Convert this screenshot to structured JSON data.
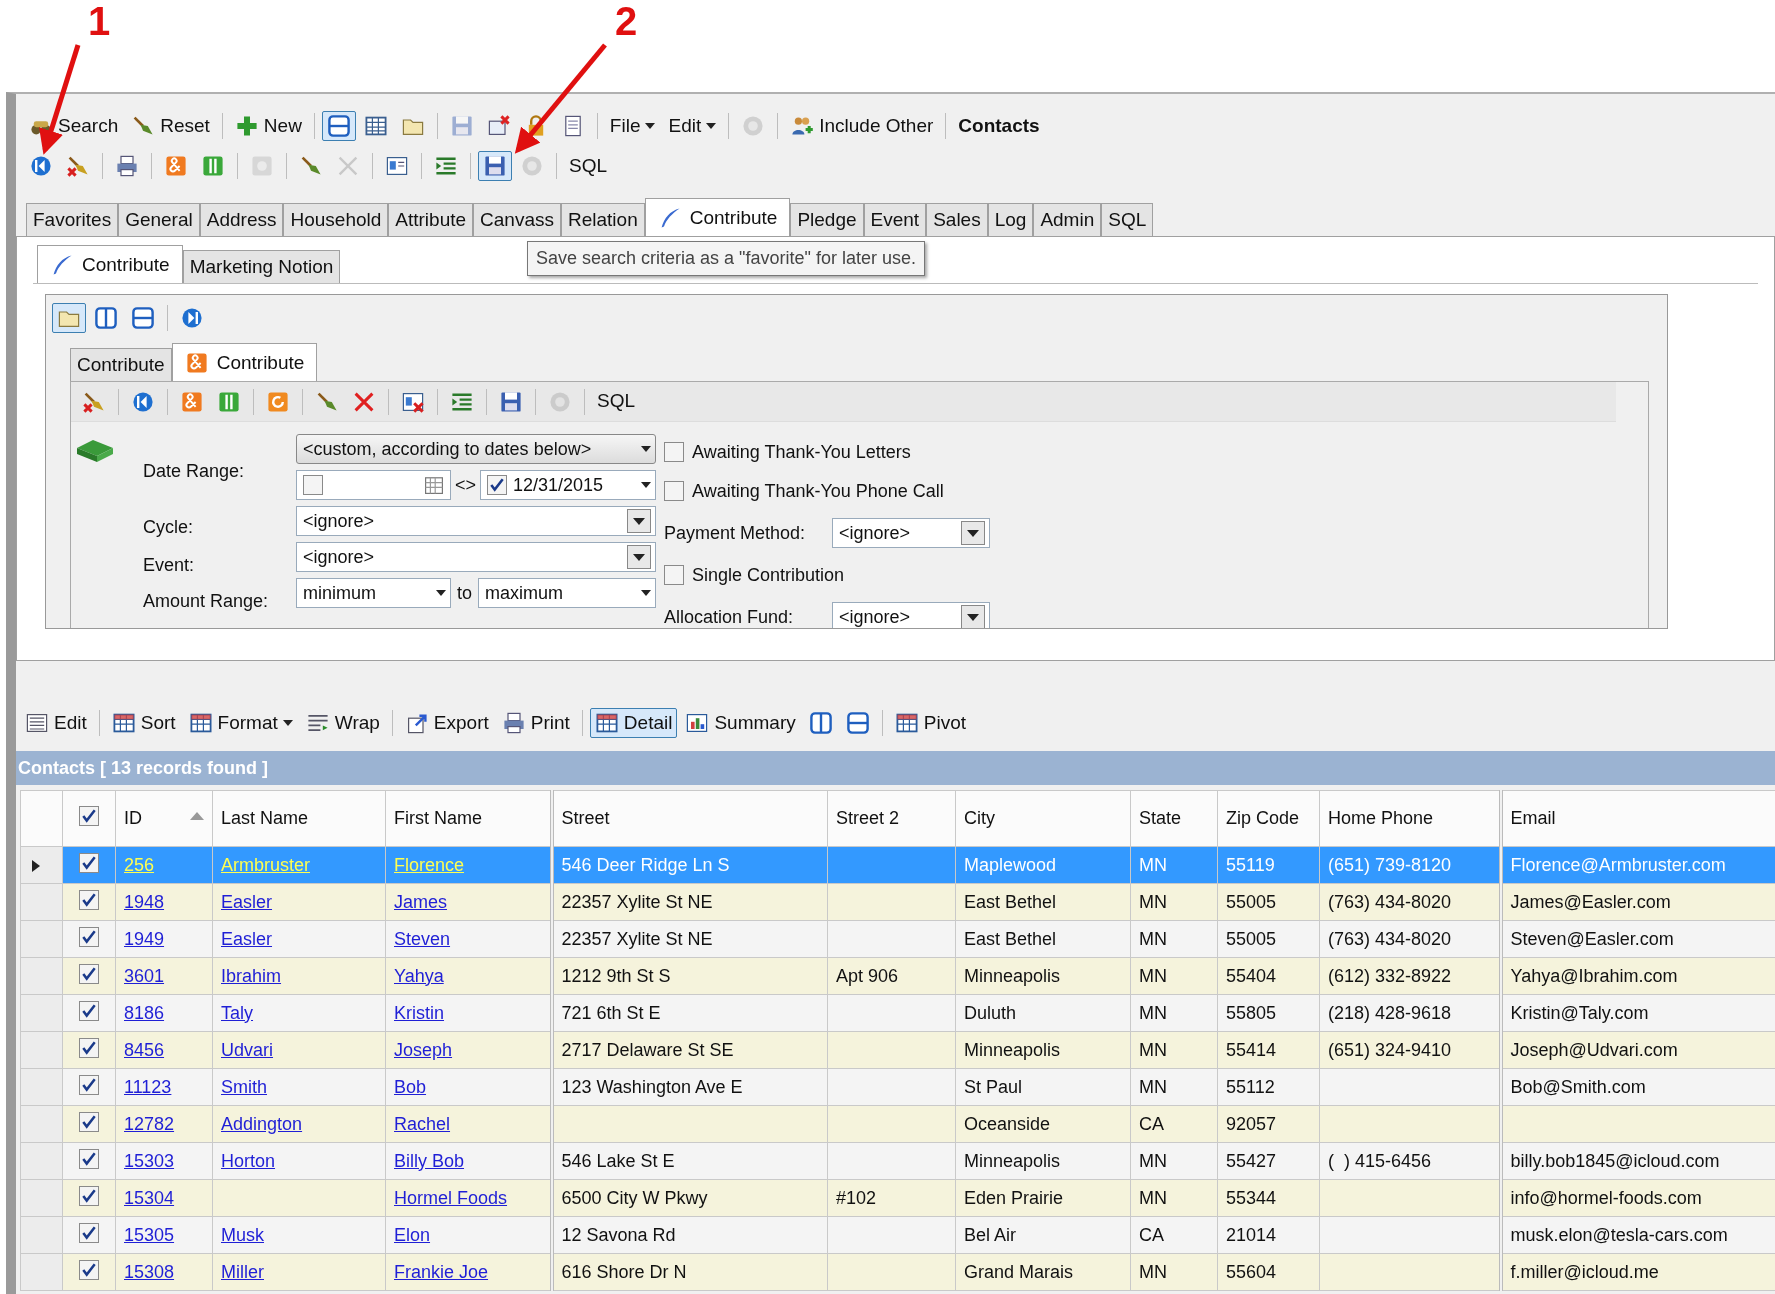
{
  "annotations": [
    {
      "label": "1"
    },
    {
      "label": "2"
    }
  ],
  "main_toolbar": [
    {
      "kind": "button",
      "label": "Search",
      "pressed": false,
      "disabled": false
    },
    {
      "kind": "button",
      "label": "Reset",
      "pressed": false,
      "disabled": false
    },
    {
      "kind": "button",
      "label": "New",
      "pressed": false,
      "disabled": false
    },
    {
      "kind": "icon",
      "pressed": true,
      "disabled": false
    },
    {
      "kind": "icon",
      "pressed": false,
      "disabled": false
    },
    {
      "kind": "icon",
      "pressed": false,
      "disabled": false
    },
    {
      "kind": "icon",
      "pressed": false,
      "disabled": true
    },
    {
      "kind": "icon",
      "pressed": false,
      "disabled": false
    },
    {
      "kind": "icon",
      "pressed": false,
      "disabled": false
    },
    {
      "kind": "icon",
      "pressed": false,
      "disabled": false
    },
    {
      "kind": "menu",
      "label": "File",
      "pressed": false,
      "disabled": false
    },
    {
      "kind": "menu",
      "label": "Edit",
      "pressed": false,
      "disabled": false
    },
    {
      "kind": "icon",
      "pressed": false,
      "disabled": true
    },
    {
      "kind": "button",
      "label": "Include Other",
      "pressed": false,
      "disabled": false
    },
    {
      "kind": "title",
      "label": "Contacts",
      "pressed": false,
      "disabled": false
    }
  ],
  "search_toolbar": [
    {
      "kind": "icon",
      "pressed": false,
      "disabled": false
    },
    {
      "kind": "icon",
      "pressed": false,
      "disabled": false
    },
    {
      "kind": "icon",
      "pressed": false,
      "disabled": false
    },
    {
      "kind": "icon",
      "pressed": false,
      "disabled": false
    },
    {
      "kind": "icon",
      "pressed": false,
      "disabled": false
    },
    {
      "kind": "icon",
      "pressed": false,
      "disabled": true
    },
    {
      "kind": "icon",
      "pressed": false,
      "disabled": false
    },
    {
      "kind": "icon",
      "pressed": false,
      "disabled": true
    },
    {
      "kind": "icon",
      "pressed": false,
      "disabled": false
    },
    {
      "kind": "icon",
      "pressed": false,
      "disabled": false
    },
    {
      "kind": "icon",
      "pressed": true,
      "disabled": false
    },
    {
      "kind": "icon",
      "pressed": false,
      "disabled": true
    },
    {
      "kind": "button",
      "label": "SQL",
      "pressed": false,
      "disabled": false
    }
  ],
  "tabs": [
    {
      "label": "Favorites",
      "selected": false
    },
    {
      "label": "General",
      "selected": false
    },
    {
      "label": "Address",
      "selected": false
    },
    {
      "label": "Household",
      "selected": false
    },
    {
      "label": "Attribute",
      "selected": false
    },
    {
      "label": "Canvass",
      "selected": false
    },
    {
      "label": "Relation",
      "selected": false
    },
    {
      "label": "Contribute",
      "selected": true
    },
    {
      "label": "Pledge",
      "selected": false
    },
    {
      "label": "Event",
      "selected": false
    },
    {
      "label": "Sales",
      "selected": false
    },
    {
      "label": "Log",
      "selected": false
    },
    {
      "label": "Admin",
      "selected": false
    },
    {
      "label": "SQL",
      "selected": false
    }
  ],
  "sub_tabs": [
    {
      "label": "Contribute",
      "selected": true
    },
    {
      "label": "Marketing Notion",
      "selected": false
    }
  ],
  "tooltip": "Save search criteria as a \"favorite\" for later use.",
  "panel_toolbar": [
    {
      "kind": "icon",
      "pressed": true,
      "disabled": false
    },
    {
      "kind": "icon",
      "pressed": false,
      "disabled": false
    },
    {
      "kind": "icon",
      "pressed": false,
      "disabled": false
    },
    {
      "kind": "icon",
      "pressed": false,
      "disabled": false
    }
  ],
  "inner_tabs": [
    {
      "label": "Contribute",
      "selected": false
    },
    {
      "label": "Contribute",
      "selected": true
    }
  ],
  "contribute_toolbar": [
    {
      "kind": "icon",
      "pressed": false,
      "disabled": false
    },
    {
      "kind": "icon",
      "pressed": false,
      "disabled": false
    },
    {
      "kind": "icon",
      "pressed": false,
      "disabled": false
    },
    {
      "kind": "icon",
      "pressed": false,
      "disabled": false
    },
    {
      "kind": "icon",
      "pressed": false,
      "disabled": false
    },
    {
      "kind": "icon",
      "pressed": false,
      "disabled": false
    },
    {
      "kind": "icon",
      "pressed": false,
      "disabled": false
    },
    {
      "kind": "icon",
      "pressed": false,
      "disabled": false
    },
    {
      "kind": "icon",
      "pressed": false,
      "disabled": false
    },
    {
      "kind": "icon",
      "pressed": false,
      "disabled": false
    },
    {
      "kind": "icon",
      "pressed": false,
      "disabled": true
    },
    {
      "kind": "button",
      "label": "SQL",
      "pressed": false,
      "disabled": false
    }
  ],
  "criteria": {
    "date_range": {
      "label": "Date Range:",
      "value": "<custom, according to dates below>",
      "from": {
        "checked": false
      },
      "separator": "<>",
      "to": {
        "checked": true,
        "value": "12/31/2015"
      }
    },
    "cycle": {
      "label": "Cycle:",
      "value": "<ignore>"
    },
    "event": {
      "label": "Event:",
      "value": "<ignore>"
    },
    "amount_range": {
      "label": "Amount Range:",
      "min": "minimum",
      "joiner": "to",
      "max": "maximum"
    },
    "options": [
      {
        "kind": "checkbox",
        "label": "Awaiting Thank-You Letters",
        "checked": false
      },
      {
        "kind": "checkbox",
        "label": "Awaiting Thank-You Phone Call",
        "checked": false
      },
      {
        "kind": "select",
        "label": "Payment Method:",
        "value": "<ignore>"
      },
      {
        "kind": "checkbox",
        "label": "Single Contribution",
        "checked": false
      },
      {
        "kind": "select",
        "label": "Allocation Fund:",
        "value": "<ignore>"
      }
    ]
  },
  "grid_toolbar": [
    {
      "kind": "button",
      "label": "Edit",
      "pressed": false,
      "disabled": false
    },
    {
      "kind": "button",
      "label": "Sort",
      "pressed": false,
      "disabled": false
    },
    {
      "kind": "menu",
      "label": "Format",
      "pressed": false,
      "disabled": false
    },
    {
      "kind": "button",
      "label": "Wrap",
      "pressed": false,
      "disabled": false
    },
    {
      "kind": "button",
      "label": "Export",
      "pressed": false,
      "disabled": false
    },
    {
      "kind": "button",
      "label": "Print",
      "pressed": false,
      "disabled": false
    },
    {
      "kind": "button",
      "label": "Detail",
      "pressed": true,
      "disabled": false
    },
    {
      "kind": "button",
      "label": "Summary",
      "pressed": false,
      "disabled": false
    },
    {
      "kind": "icon",
      "pressed": false,
      "disabled": false
    },
    {
      "kind": "icon",
      "pressed": false,
      "disabled": false
    },
    {
      "kind": "button",
      "label": "Pivot",
      "pressed": false,
      "disabled": false
    }
  ],
  "results": {
    "title": "Contacts [ 13 records found ]",
    "all_checked": true,
    "columns": [
      {
        "label": "ID",
        "sorted": true
      },
      {
        "label": "Last Name",
        "sorted": false
      },
      {
        "label": "First Name",
        "sorted": false
      },
      {
        "label": "Street",
        "sorted": false
      },
      {
        "label": "Street 2",
        "sorted": false
      },
      {
        "label": "City",
        "sorted": false
      },
      {
        "label": "State",
        "sorted": false
      },
      {
        "label": "Zip Code",
        "sorted": false
      },
      {
        "label": "Home Phone",
        "sorted": false
      },
      {
        "label": "Email",
        "sorted": false
      }
    ],
    "rows": [
      {
        "selected": true,
        "checked": true,
        "id": "256",
        "last_name": "Armbruster",
        "first_name": "Florence",
        "street": "546 Deer Ridge Ln S",
        "city": "Maplewood",
        "state": "MN",
        "zip_code": "55119",
        "home_phone": "(651) 739-8120",
        "email": "Florence@Armbruster.com"
      },
      {
        "selected": false,
        "checked": true,
        "id": "1948",
        "last_name": "Easler",
        "first_name": "James",
        "street": "22357 Xylite St NE",
        "city": "East Bethel",
        "state": "MN",
        "zip_code": "55005",
        "home_phone": "(763) 434-8020",
        "email": "James@Easler.com"
      },
      {
        "selected": false,
        "checked": true,
        "id": "1949",
        "last_name": "Easler",
        "first_name": "Steven",
        "street": "22357 Xylite St NE",
        "city": "East Bethel",
        "state": "MN",
        "zip_code": "55005",
        "home_phone": "(763) 434-8020",
        "email": "Steven@Easler.com"
      },
      {
        "selected": false,
        "checked": true,
        "id": "3601",
        "last_name": "Ibrahim",
        "first_name": "Yahya",
        "street": "1212 9th St S",
        "street_2": "Apt 906",
        "city": "Minneapolis",
        "state": "MN",
        "zip_code": "55404",
        "home_phone": "(612) 332-8922",
        "email": "Yahya@Ibrahim.com"
      },
      {
        "selected": false,
        "checked": true,
        "id": "8186",
        "last_name": "Taly",
        "first_name": "Kristin",
        "street": "721 6th St E",
        "city": "Duluth",
        "state": "MN",
        "zip_code": "55805",
        "home_phone": "(218) 428-9618",
        "email": "Kristin@Taly.com"
      },
      {
        "selected": false,
        "checked": true,
        "id": "8456",
        "last_name": "Udvari",
        "first_name": "Joseph",
        "street": "2717 Delaware St SE",
        "city": "Minneapolis",
        "state": "MN",
        "zip_code": "55414",
        "home_phone": "(651) 324-9410",
        "email": "Joseph@Udvari.com"
      },
      {
        "selected": false,
        "checked": true,
        "id": "11123",
        "last_name": "Smith",
        "first_name": "Bob",
        "street": "123 Washington Ave E",
        "city": "St Paul",
        "state": "MN",
        "zip_code": "55112",
        "email": "Bob@Smith.com"
      },
      {
        "selected": false,
        "checked": true,
        "id": "12782",
        "last_name": "Addington",
        "first_name": "Rachel",
        "city": "Oceanside",
        "state": "CA",
        "zip_code": "92057"
      },
      {
        "selected": false,
        "checked": true,
        "id": "15303",
        "last_name": "Horton",
        "first_name": "Billy Bob",
        "street": "546 Lake St E",
        "city": "Minneapolis",
        "state": "MN",
        "zip_code": "55427",
        "home_phone": "(  ) 415-6456",
        "email": "billy.bob1845@icloud.com"
      },
      {
        "selected": false,
        "checked": true,
        "id": "15304",
        "first_name": "Hormel Foods",
        "street": "6500 City W Pkwy",
        "street_2": "#102",
        "city": "Eden Prairie",
        "state": "MN",
        "zip_code": "55344",
        "email": "info@hormel-foods.com"
      },
      {
        "selected": false,
        "checked": true,
        "id": "15305",
        "last_name": "Musk",
        "first_name": "Elon",
        "street": "12 Savona Rd",
        "city": "Bel Air",
        "state": "CA",
        "zip_code": "21014",
        "email": "musk.elon@tesla-cars.com"
      },
      {
        "selected": false,
        "checked": true,
        "id": "15308",
        "last_name": "Miller",
        "first_name": "Frankie Joe",
        "street": "616 Shore Dr N",
        "city": "Grand Marais",
        "state": "MN",
        "zip_code": "55604",
        "email": "f.miller@icloud.me"
      }
    ]
  }
}
